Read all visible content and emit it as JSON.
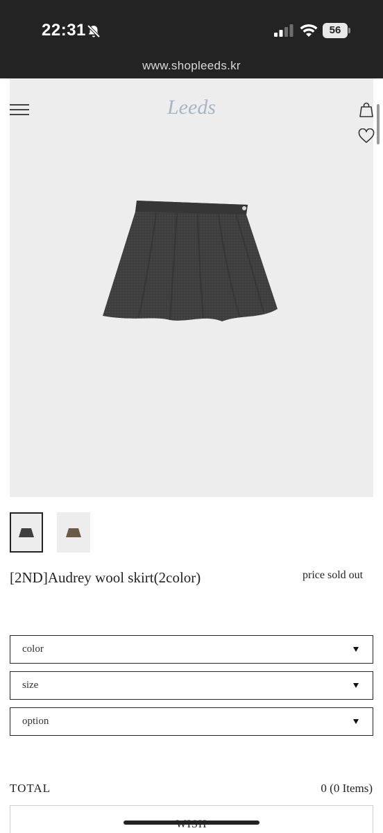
{
  "status_bar": {
    "time": "22:31",
    "battery_level": "56",
    "icons": [
      "bell-slash-icon",
      "cellular-signal-icon",
      "wifi-icon",
      "battery-icon"
    ]
  },
  "browser": {
    "url": "www.shopleeds.kr"
  },
  "header": {
    "logo_text": "Leeds",
    "logo_color": "#a6b6c6",
    "icons": [
      "hamburger-menu-icon",
      "shopping-bag-icon",
      "heart-icon"
    ]
  },
  "product": {
    "name": "[2ND]Audrey wool skirt(2color)",
    "price_label": "price sold out",
    "thumbnails": [
      "charcoal",
      "brown"
    ],
    "colors": {
      "charcoal": "#3f3f40",
      "brown": "#6b5a45",
      "background": "#ecedec"
    }
  },
  "options": [
    {
      "label": "color"
    },
    {
      "label": "size"
    },
    {
      "label": "option"
    }
  ],
  "total": {
    "label": "TOTAL",
    "value": "0 (0 Items)"
  },
  "actions": {
    "wish_label": "WISH"
  }
}
